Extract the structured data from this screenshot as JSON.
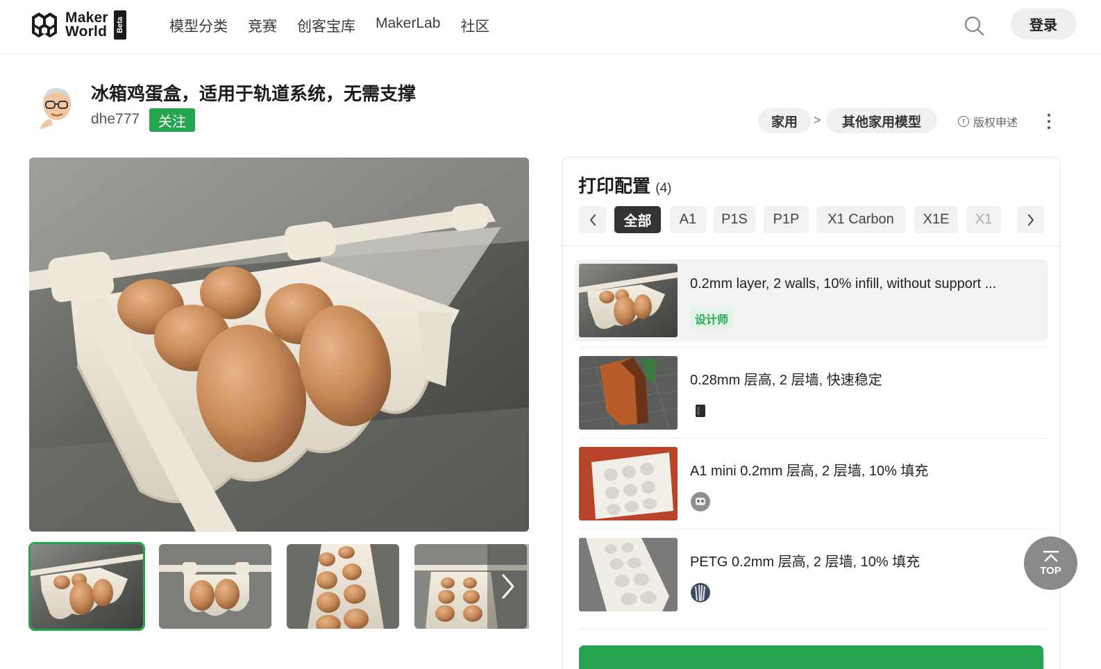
{
  "header": {
    "logo_text_line1": "Maker",
    "logo_text_line2": "World",
    "logo_badge": "Beta",
    "nav": [
      "模型分类",
      "竞赛",
      "创客宝库",
      "MakerLab",
      "社区"
    ],
    "login_label": "登录"
  },
  "model": {
    "title": "冰箱鸡蛋盒，适用于轨道系统，无需支撑",
    "author": "dhe777",
    "follow_label": "关注",
    "breadcrumb": [
      "家用",
      "其他家用模型"
    ],
    "breadcrumb_separator": ">",
    "copyright_label": "版权申述"
  },
  "print_profiles": {
    "title": "打印配置",
    "count": "(4)",
    "tabs": [
      "全部",
      "A1",
      "P1S",
      "P1P",
      "X1 Carbon",
      "X1E",
      "X1"
    ],
    "active_tab": "全部",
    "items": [
      {
        "name": "0.2mm layer, 2 walls, 10% infill, without support ...",
        "badge": "设计师",
        "active": true
      },
      {
        "name": "0.28mm 层高, 2 层墙, 快速稳定",
        "icon": "user-avatar-icon"
      },
      {
        "name": "A1 mini 0.2mm 层高, 2 层墙, 10% 填充",
        "icon": "user-avatar-icon"
      },
      {
        "name": "PETG 0.2mm 层高, 2 层墙, 10% 填充",
        "icon": "user-avatar-icon"
      }
    ]
  },
  "back_to_top": "TOP",
  "colors": {
    "brand_green": "#26a550",
    "active_tab": "#333333",
    "chip_bg": "#f0f0f0"
  }
}
